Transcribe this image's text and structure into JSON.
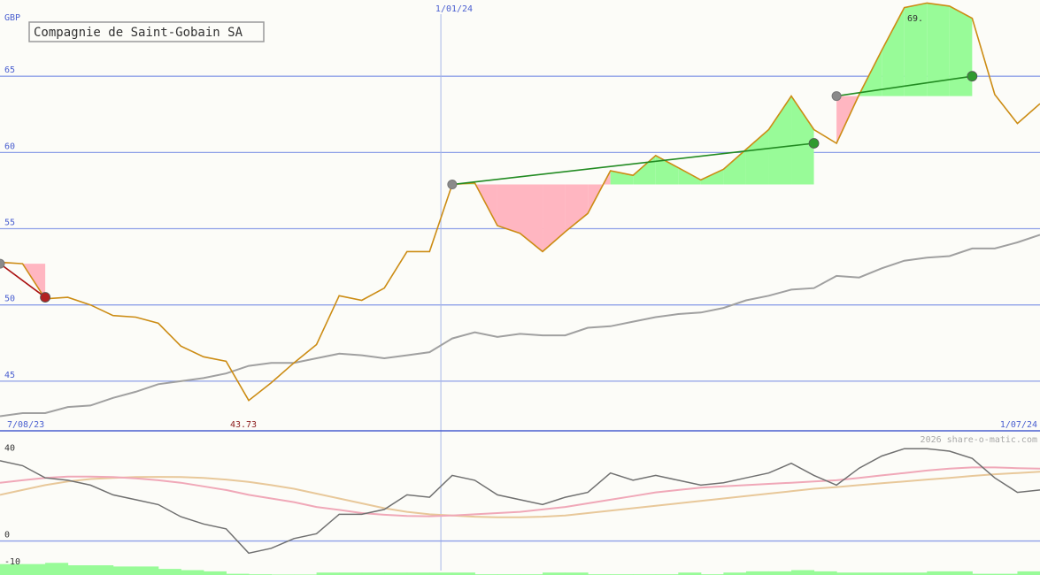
{
  "chart_data": [
    {
      "type": "line",
      "title": "Compagnie de Saint-Gobain SA",
      "unit": "GBP",
      "date_start": "7/08/23",
      "date_mid": "1/01/24",
      "date_end": "1/07/24",
      "low_marker": "43.73",
      "high_marker": "69.",
      "ylim": [
        41.8,
        70.0
      ],
      "yticks": [
        45,
        50,
        55,
        60,
        65
      ],
      "grid": true,
      "x_count": 46,
      "x_mid_index": 19.5,
      "colors": {
        "price": "#cc8c14",
        "average": "#a0a0a0",
        "gain_fill": "#98fb98",
        "loss_fill": "#ffb6c1",
        "gain_line": "#228b22",
        "loss_line": "#aa1111",
        "grid": "#8ea0e8"
      },
      "series": [
        {
          "values": [
            52.8,
            52.7,
            50.4,
            50.5,
            50.0,
            49.3,
            49.2,
            48.8,
            47.3,
            46.6,
            46.3,
            43.73,
            44.9,
            46.2,
            47.4,
            50.6,
            50.3,
            51.1,
            53.5,
            53.5,
            57.9,
            58.0,
            55.2,
            54.7,
            53.5,
            54.8,
            56.0,
            58.8,
            58.5,
            59.8,
            59.0,
            58.2,
            58.9,
            60.2,
            61.5,
            63.7,
            61.5,
            60.6,
            63.8,
            66.7,
            69.5,
            69.8,
            69.6,
            68.8,
            63.8,
            61.9,
            63.2
          ]
        },
        {
          "values": [
            42.7,
            42.9,
            42.9,
            43.3,
            43.4,
            43.9,
            44.3,
            44.8,
            45.0,
            45.2,
            45.5,
            46.0,
            46.2,
            46.2,
            46.5,
            46.8,
            46.7,
            46.5,
            46.7,
            46.9,
            47.8,
            48.2,
            47.9,
            48.1,
            48.0,
            48.0,
            48.5,
            48.6,
            48.9,
            49.2,
            49.4,
            49.5,
            49.8,
            50.3,
            50.6,
            51.0,
            51.1,
            51.9,
            51.8,
            52.4,
            52.9,
            53.1,
            53.2,
            53.7,
            53.7,
            54.1,
            54.6
          ]
        }
      ],
      "trades": [
        {
          "kind": "loss",
          "start": 0,
          "end": 2,
          "start_value": 52.7,
          "end_value": 50.5
        },
        {
          "kind": "gain",
          "start": 20,
          "end": 36,
          "start_value": 57.9,
          "end_value": 60.6
        },
        {
          "kind": "gain",
          "start": 37,
          "end": 43,
          "start_value": 63.7,
          "end_value": 65.0
        }
      ]
    },
    {
      "type": "line",
      "ylim": [
        -14,
        45
      ],
      "yticks": [
        40,
        0,
        -10
      ],
      "copyright": "2026 share-o-matic.com",
      "colors": {
        "momentum": "#707070",
        "fast_average": "#f0a8b8",
        "slow_average": "#e8c89a",
        "histogram": "#98fb98",
        "zero_line": "#8ea0e8"
      },
      "series": [
        {
          "values": [
            33,
            31,
            26,
            25,
            23,
            19,
            17,
            15,
            10,
            7,
            5,
            -5,
            -3,
            1,
            3,
            11,
            11,
            13,
            19,
            18,
            27,
            25,
            19,
            17,
            15,
            18,
            20,
            28,
            25,
            27,
            25,
            23,
            24,
            26,
            28,
            32,
            27,
            23,
            30,
            35,
            38,
            38,
            37,
            34,
            26,
            20,
            21
          ]
        },
        {
          "values": [
            24,
            25,
            26,
            26.5,
            26.5,
            26.3,
            25.8,
            25,
            24,
            22.5,
            21,
            19,
            17.5,
            16,
            14,
            12.8,
            11.5,
            10.8,
            10.3,
            10.2,
            10.5,
            11,
            11.5,
            12,
            13,
            14,
            15.5,
            17,
            18.5,
            20,
            21,
            22,
            22.5,
            23,
            23.5,
            24,
            24.5,
            25,
            26,
            27,
            28,
            29,
            29.8,
            30.3,
            30.3,
            30,
            29.8
          ]
        },
        {
          "values": [
            19,
            21,
            23,
            24.5,
            25.5,
            26,
            26.3,
            26.4,
            26.3,
            26,
            25.3,
            24.3,
            23,
            21.5,
            19.5,
            17.5,
            15.5,
            13.5,
            12,
            11,
            10.5,
            10,
            9.8,
            9.8,
            10,
            10.5,
            11.5,
            12.5,
            13.5,
            14.5,
            15.5,
            16.5,
            17.5,
            18.5,
            19.5,
            20.5,
            21.5,
            22.2,
            23,
            23.8,
            24.5,
            25.3,
            26,
            26.8,
            27.5,
            28,
            28.5
          ]
        },
        {
          "values": [
            -4.5,
            -4.5,
            -5,
            -4,
            -4,
            -3.5,
            -3.5,
            -2.5,
            -2,
            -1.5,
            -0.5,
            -0.3,
            -0.2,
            -0.2,
            -1,
            -1,
            -1,
            -1,
            -1,
            -1,
            -1,
            -0.3,
            -0.3,
            -0.3,
            -1,
            -1,
            -0.3,
            -0.3,
            -0.3,
            -0.3,
            -1,
            -0.3,
            -1,
            -1.5,
            -1.5,
            -2,
            -1.5,
            -1,
            -1,
            -1,
            -1,
            -1.5,
            -1.5,
            -0.5,
            -0.5,
            -1.5
          ]
        }
      ]
    }
  ]
}
